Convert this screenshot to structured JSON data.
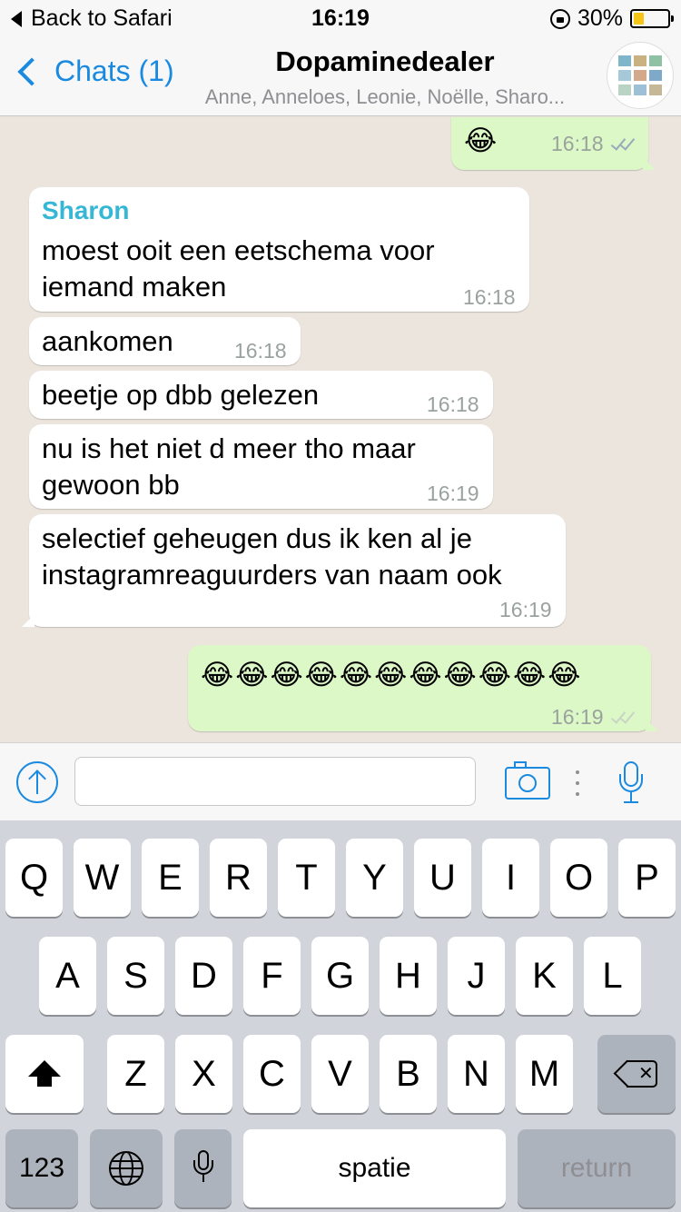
{
  "status_bar": {
    "back_label": "Back to Safari",
    "time": "16:19",
    "battery": "30%",
    "battery_level": 0.3,
    "battery_color": "#f5c518"
  },
  "nav": {
    "back_label": "Chats (1)",
    "title": "Dopaminedealer",
    "subtitle": "Anne, Anneloes, Leonie, Noëlle, Sharo..."
  },
  "messages": [
    {
      "direction": "out",
      "text": "😂",
      "time": "16:18"
    },
    {
      "direction": "in",
      "sender": "Sharon",
      "text": "moest ooit een eetschema voor iemand maken",
      "time": "16:18"
    },
    {
      "direction": "in",
      "text": "aankomen",
      "time": "16:18"
    },
    {
      "direction": "in",
      "text": "beetje op dbb gelezen",
      "time": "16:18"
    },
    {
      "direction": "in",
      "text": "nu is het niet d meer tho maar gewoon bb",
      "time": "16:19"
    },
    {
      "direction": "in",
      "text": "selectief geheugen dus ik ken al je instagramreaguurders van naam ook",
      "time": "16:19"
    },
    {
      "direction": "out",
      "text": "😂😂😂😂😂😂😂😂😂😂😂",
      "time": "16:19"
    }
  ],
  "input": {
    "placeholder": ""
  },
  "keyboard": {
    "row1": [
      "Q",
      "W",
      "E",
      "R",
      "T",
      "Y",
      "U",
      "I",
      "O",
      "P"
    ],
    "row2": [
      "A",
      "S",
      "D",
      "F",
      "G",
      "H",
      "J",
      "K",
      "L"
    ],
    "row3": [
      "Z",
      "X",
      "C",
      "V",
      "B",
      "N",
      "M"
    ],
    "numbers_label": "123",
    "space_label": "spatie",
    "return_label": "return"
  },
  "colors": {
    "accent": "#1a8ae0",
    "sender_name": "#35b7d5",
    "outgoing_bubble": "#dcf8c6",
    "chat_background": "#ece5dd"
  },
  "icons": [
    "back-triangle-icon",
    "lock-icon",
    "battery-icon",
    "chevron-left-icon",
    "group-avatar",
    "attach-icon",
    "camera-icon",
    "more-dots-icon",
    "microphone-icon",
    "shift-icon",
    "delete-icon",
    "globe-icon",
    "dictation-icon",
    "read-receipt-icon"
  ]
}
